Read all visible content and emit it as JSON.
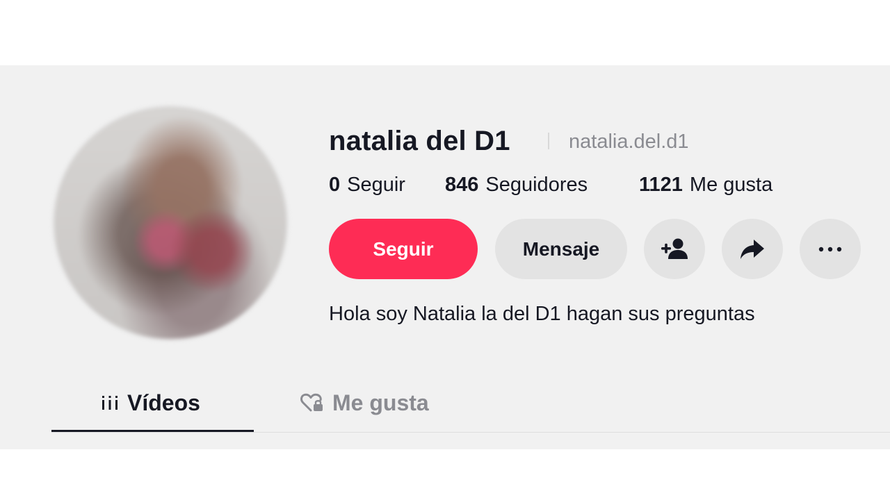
{
  "profile": {
    "display_name": "natalia del D1",
    "handle": "natalia.del.d1",
    "bio": "Hola soy Natalia la del D1 hagan sus preguntas"
  },
  "stats": {
    "following_count": "0",
    "following_label": "Seguir",
    "followers_count": "846",
    "followers_label": "Seguidores",
    "likes_count": "1121",
    "likes_label": "Me gusta"
  },
  "actions": {
    "follow_label": "Seguir",
    "message_label": "Mensaje",
    "add_friend_icon": "add-user-icon",
    "share_icon": "share-arrow-icon",
    "more_icon": "more-dots-icon"
  },
  "tabs": [
    {
      "label": "Vídeos",
      "icon": "grid-bars-icon",
      "active": true
    },
    {
      "label": "Me gusta",
      "icon": "heart-lock-icon",
      "active": false
    }
  ],
  "colors": {
    "accent": "#fe2c55",
    "text": "#161823",
    "muted": "#8a8b91",
    "button_bg": "#e3e3e3"
  }
}
